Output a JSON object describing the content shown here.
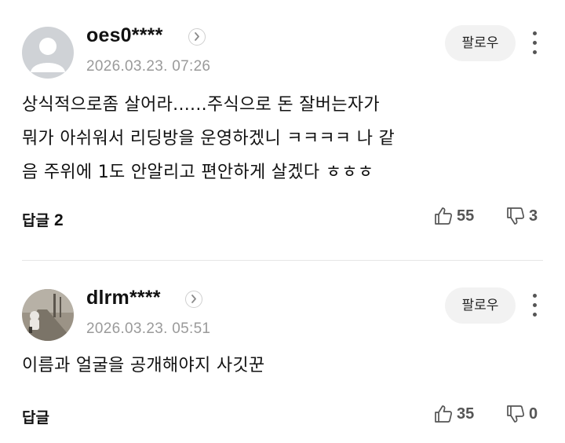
{
  "comments": [
    {
      "username": "oes0****",
      "timestamp": "2026.03.23. 07:26",
      "follow_label": "팔로우",
      "text_lines": [
        "상식적으로좀 살어라......주식으로 돈 잘버는자가",
        "뭐가 아쉬워서 리딩방을 운영하겠니 ㅋㅋㅋㅋ 나 같",
        "음 주위에 1도 안알리고 편안하게 살겠다 ㅎㅎㅎ"
      ],
      "reply_label": "답글",
      "reply_count": "2",
      "likes": "55",
      "dislikes": "3",
      "avatar": "default-person-icon"
    },
    {
      "username": "dlrm****",
      "timestamp": "2026.03.23. 05:51",
      "follow_label": "팔로우",
      "text_lines": [
        "이름과 얼굴을 공개해야지 사깃꾼"
      ],
      "reply_label": "답글",
      "reply_count": "",
      "likes": "35",
      "dislikes": "0",
      "avatar": "photo-avatar"
    }
  ],
  "colors": {
    "text": "#111111",
    "muted": "#9a9a9a",
    "button_bg": "#f2f2f2",
    "icon": "#555555"
  }
}
